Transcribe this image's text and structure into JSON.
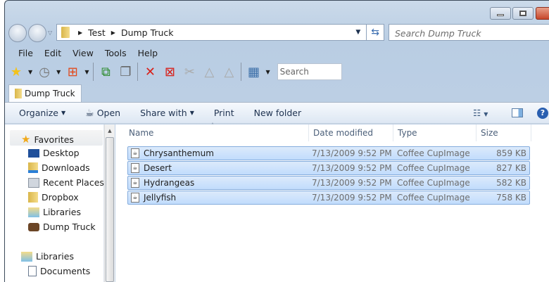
{
  "window": {
    "minimize": "–",
    "maximize": "□",
    "close": "✕"
  },
  "address": {
    "crumbs": [
      "Test",
      "Dump Truck"
    ],
    "search_placeholder": "Search Dump Truck"
  },
  "menu": [
    "File",
    "Edit",
    "View",
    "Tools",
    "Help"
  ],
  "toolbar": {
    "search_placeholder": "Search"
  },
  "tab": {
    "label": "Dump Truck"
  },
  "commands": {
    "organize": "Organize",
    "open": "Open",
    "share": "Share with",
    "print": "Print",
    "new_folder": "New folder"
  },
  "nav": {
    "favorites": "Favorites",
    "items": [
      "Desktop",
      "Downloads",
      "Recent Places",
      "Dropbox",
      "Libraries",
      "Dump Truck"
    ],
    "libraries": "Libraries",
    "lib_items": [
      "Documents"
    ]
  },
  "columns": {
    "name": "Name",
    "date": "Date modified",
    "type": "Type",
    "size": "Size"
  },
  "files": [
    {
      "name": "Chrysanthemum",
      "date": "7/13/2009 9:52 PM",
      "type": "Coffee CupImage",
      "size": "859 KB"
    },
    {
      "name": "Desert",
      "date": "7/13/2009 9:52 PM",
      "type": "Coffee CupImage",
      "size": "827 KB"
    },
    {
      "name": "Hydrangeas",
      "date": "7/13/2009 9:52 PM",
      "type": "Coffee CupImage",
      "size": "582 KB"
    },
    {
      "name": "Jellyfish",
      "date": "7/13/2009 9:52 PM",
      "type": "Coffee CupImage",
      "size": "758 KB"
    }
  ]
}
